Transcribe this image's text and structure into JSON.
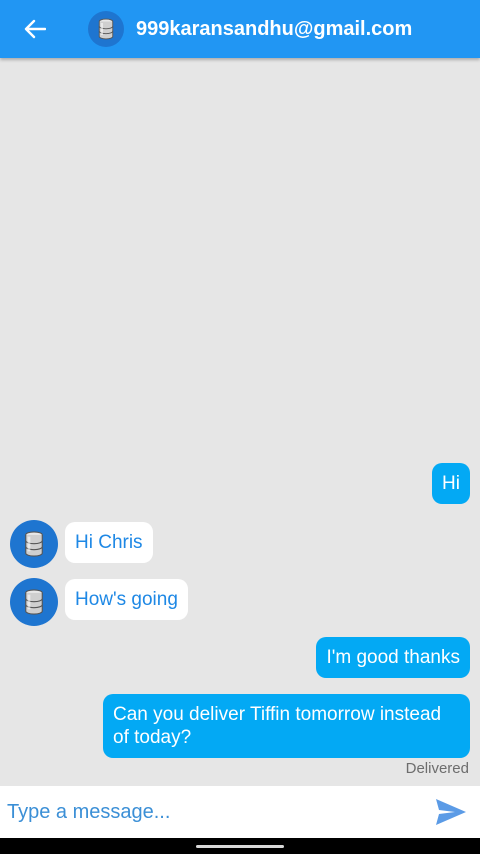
{
  "header": {
    "title": "999karansandhu@gmail.com",
    "back_icon": "arrow-left-icon",
    "avatar_icon": "server-database-icon"
  },
  "messages": [
    {
      "direction": "outgoing",
      "text": "Hi"
    },
    {
      "direction": "incoming",
      "text": "Hi Chris"
    },
    {
      "direction": "incoming",
      "text": "How's going"
    },
    {
      "direction": "outgoing",
      "text": "I'm good thanks"
    },
    {
      "direction": "outgoing",
      "text": "Can you deliver Tiffin tomorrow instead of today?"
    }
  ],
  "status": {
    "delivered": "Delivered"
  },
  "composer": {
    "placeholder": "Type a message...",
    "send_icon": "send-icon"
  },
  "colors": {
    "appbar": "#2196f3",
    "outgoing_bubble": "#03a9f4",
    "incoming_text": "#1e88e5",
    "chat_background": "#e6e6e6"
  }
}
